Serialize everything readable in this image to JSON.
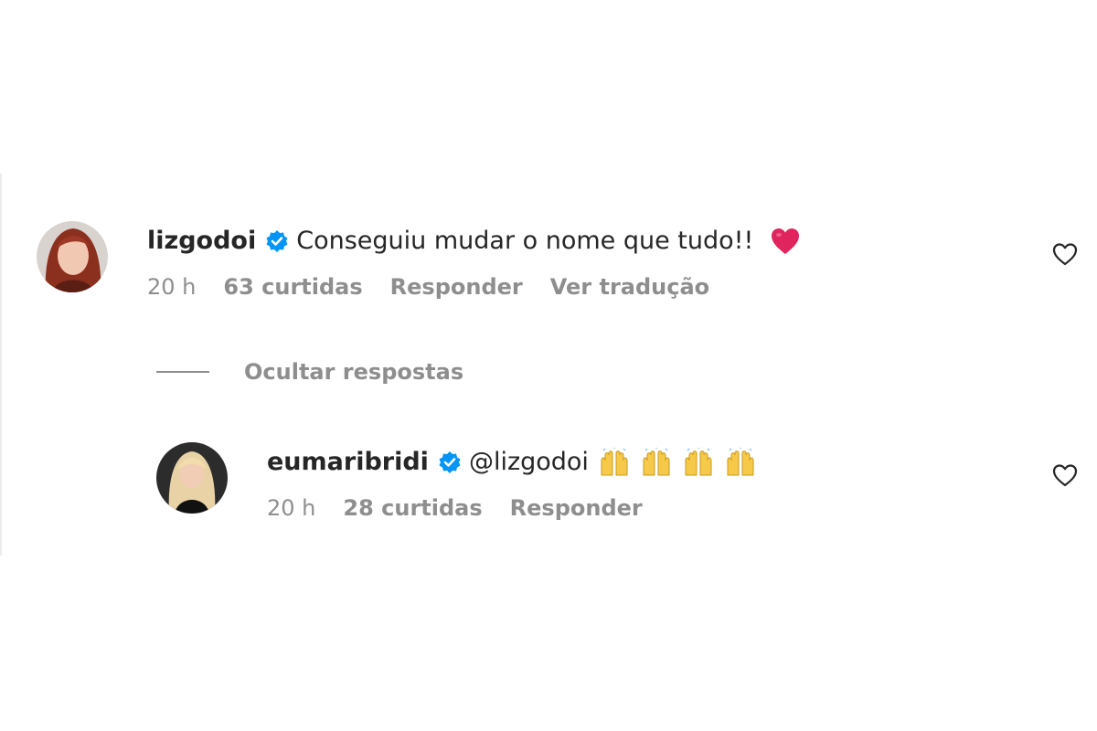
{
  "comments": [
    {
      "username": "lizgodoi",
      "text": "Conseguiu mudar o nome que tudo!!",
      "time": "20 h",
      "likes": "63 curtidas",
      "reply_label": "Responder",
      "translate_label": "Ver tradução",
      "emoji": "red-heart-icon"
    }
  ],
  "replies_toggle": "Ocultar respostas",
  "replies": [
    {
      "username": "eumaribridi",
      "text": "@lizgodoi",
      "time": "20 h",
      "likes": "28 curtidas",
      "reply_label": "Responder",
      "emoji": "raising-hands-icon",
      "emoji_count": 4
    }
  ],
  "colors": {
    "verified": "#0095f6",
    "meta_text": "#8e8e8e",
    "heart_emoji": "#e0245e"
  }
}
